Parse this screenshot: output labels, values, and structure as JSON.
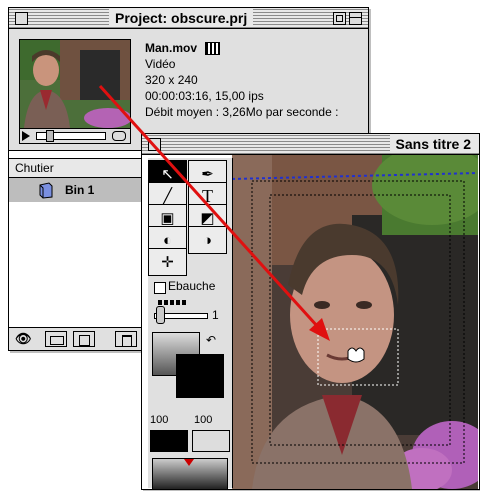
{
  "project": {
    "title": "Project: obscure.prj",
    "clip": {
      "name": "Man.mov",
      "type": "Vidéo",
      "dimensions": "320 x 240",
      "timecode": "00:00:03:16, 15,00 ips",
      "bitrate": "Débit moyen : 3,26Mo par seconde :"
    },
    "bin_header": "Chutier",
    "bins": [
      "Bin 1"
    ],
    "toolbar_icons": [
      "binoculars-icon",
      "folder-icon",
      "new-bin-icon",
      "trash-icon"
    ]
  },
  "canvas": {
    "title": "Sans titre 2",
    "draft_label": "Ebauche",
    "brush_size": "1",
    "left_zoom": "100",
    "right_zoom": "100"
  },
  "colors": {
    "annotation_arrow": "#e01010",
    "selection_guide": "#2030d0"
  }
}
